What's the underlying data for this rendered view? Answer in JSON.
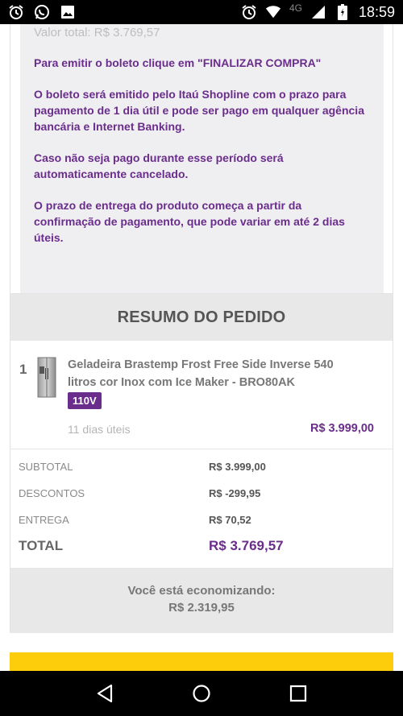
{
  "status_bar": {
    "network": "4G",
    "time": "18:59",
    "left_icons": [
      "alarm-icon",
      "whatsapp-icon",
      "image-icon"
    ],
    "right_icons": [
      "alarm-icon",
      "wifi-icon",
      "signal-icon",
      "battery-icon"
    ]
  },
  "boleto": {
    "valor_total": "Valor total: R$ 3.769,57",
    "para_emitir": "Para emitir o boleto clique em \"FINALIZAR COMPRA\"",
    "emissao": "O boleto será emitido pelo Itaú Shopline com o prazo para pagamento de 1 dia útil e pode ser pago em qualquer agência bancária e Internet Banking.",
    "cancelamento": "Caso não seja pago durante esse período será automaticamente cancelado.",
    "prazo_entrega": "O prazo de entrega do produto começa a partir da confirmação de pagamento, que pode variar em até 2 dias úteis."
  },
  "resumo": {
    "title": "RESUMO DO PEDIDO",
    "item": {
      "quantity": "1",
      "name": "Geladeira Brastemp Frost Free Side Inverse 540 litros cor Inox com Ice Maker - BRO80AK",
      "voltage": "110V",
      "delivery": "11 dias úteis",
      "price": "R$ 3.999,00",
      "image_icon": "refrigerator-icon"
    },
    "subtotal_label": "SUBTOTAL",
    "subtotal_value": "R$ 3.999,00",
    "descontos_label": "DESCONTOS",
    "descontos_value": "R$ -299,95",
    "entrega_label": "ENTREGA",
    "entrega_value": "R$ 70,52",
    "total_label": "TOTAL",
    "total_value": "R$ 3.769,57",
    "economy_label": "Você está economizando:",
    "economy_value": "R$ 2.319,95"
  },
  "colors": {
    "purple": "#6a2d8c",
    "yellow": "#fdcc0a",
    "gray_bg": "#e8e8e8"
  },
  "nav_bar": {
    "icons": [
      "back-icon",
      "home-icon",
      "recents-icon"
    ]
  }
}
